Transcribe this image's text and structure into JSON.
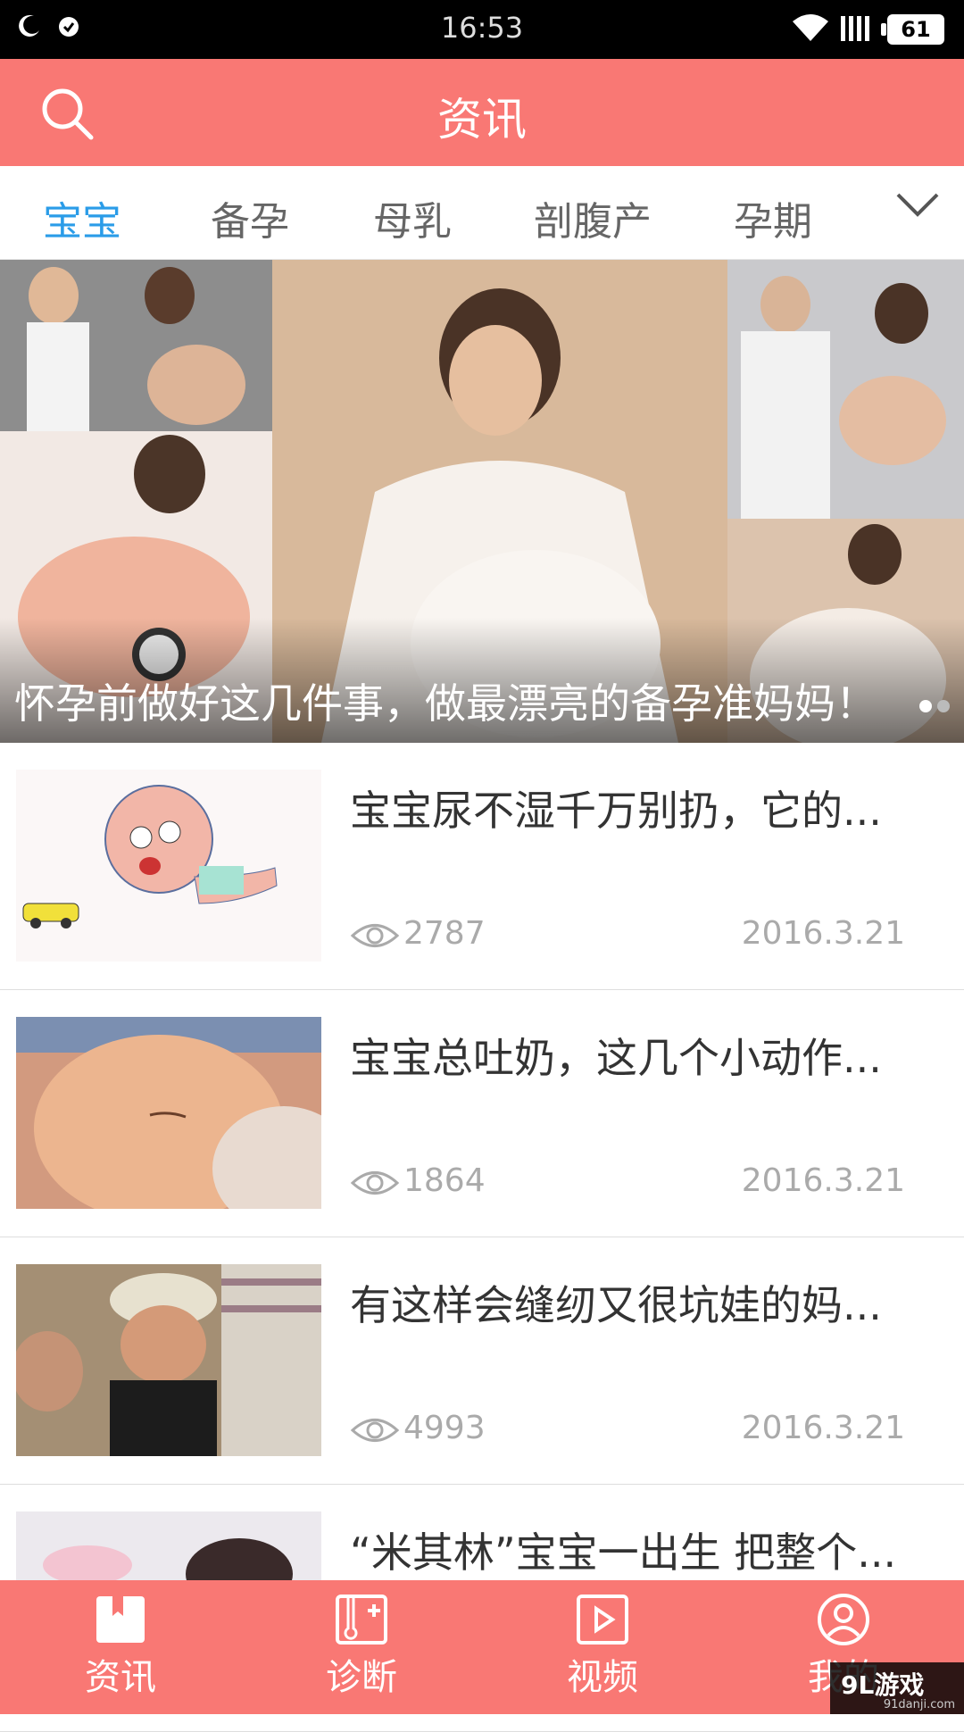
{
  "status_bar": {
    "time": "16:53",
    "battery": "61"
  },
  "header": {
    "title": "资讯"
  },
  "tabs": [
    "宝宝",
    "备孕",
    "母乳",
    "剖腹产",
    "孕期"
  ],
  "banner": {
    "caption": "怀孕前做好这几件事，做最漂亮的备孕准妈妈！"
  },
  "articles": [
    {
      "title": "宝宝尿不湿千万别扔，它的...",
      "views": "2787",
      "date": "2016.3.21"
    },
    {
      "title": "宝宝总吐奶，这几个小动作...",
      "views": "1864",
      "date": "2016.3.21"
    },
    {
      "title": "有这样会缝纫又很坑娃的妈...",
      "views": "4993",
      "date": "2016.3.21"
    },
    {
      "title": "“米其林”宝宝一出生 把整个...",
      "views": "",
      "date": ""
    }
  ],
  "bottom_nav": [
    {
      "label": "资讯",
      "icon": "book-icon"
    },
    {
      "label": "诊断",
      "icon": "diagnosis-icon"
    },
    {
      "label": "视频",
      "icon": "play-icon"
    },
    {
      "label": "我的",
      "icon": "user-icon"
    }
  ],
  "watermark": {
    "brand": "9L游戏",
    "url": "91danji.com"
  },
  "colors": {
    "primary": "#f97874",
    "tab_active": "#2a9ce8",
    "muted_text": "#aaaaaa"
  }
}
